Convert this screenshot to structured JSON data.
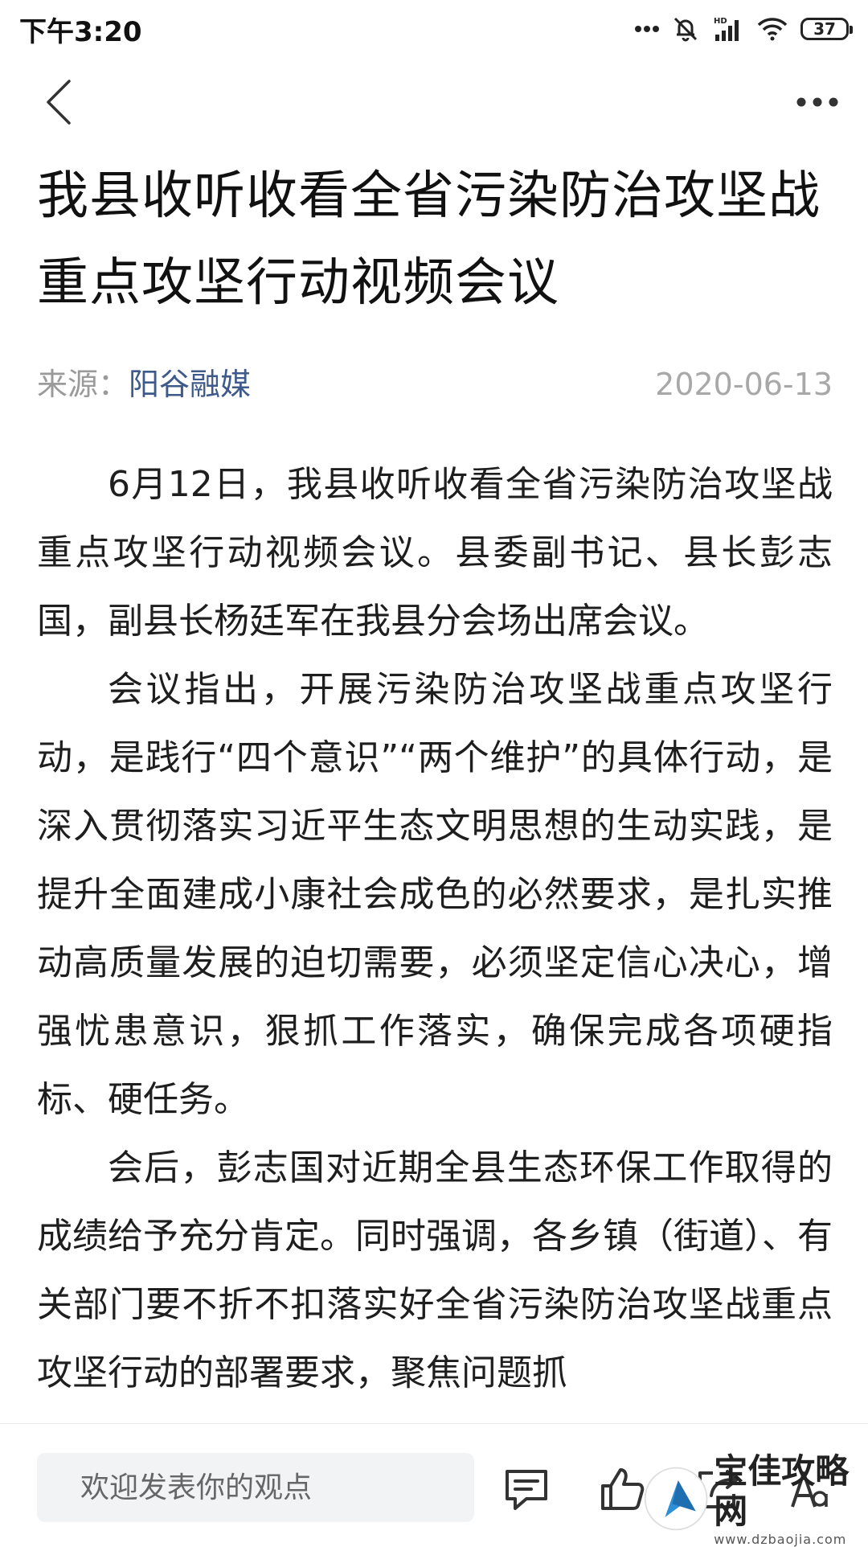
{
  "status_bar": {
    "time": "下午3:20",
    "battery": "37",
    "icons": [
      "more-dots-icon",
      "bell-off-icon",
      "hd-signal-icon",
      "wifi-icon",
      "battery-icon"
    ]
  },
  "nav": {
    "icons": [
      "back-chevron-icon",
      "more-options-icon"
    ]
  },
  "article": {
    "title": "我县收听收看全省污染防治攻坚战 重点攻坚行动视频会议",
    "source_label": "来源：",
    "source_name": "阳谷融媒",
    "date": "2020-06-13",
    "paragraphs": [
      "6月12日，我县收听收看全省污染防治攻坚战重点攻坚行动视频会议。县委副书记、县长彭志国，副县长杨廷军在我县分会场出席会议。",
      "会议指出，开展污染防治攻坚战重点攻坚行动，是践行“四个意识”“两个维护”的具体行动，是深入贯彻落实习近平生态文明思想的生动实践，是提升全面建成小康社会成色的必然要求，是扎实推动高质量发展的迫切需要，必须坚定信心决心，增强忧患意识，狠抓工作落实，确保完成各项硬指标、硬任务。",
      "会后，彭志国对近期全县生态环保工作取得的成绩给予充分肯定。同时强调，各乡镇（街道）、有关部门要不折不扣落实好全省污染防治攻坚战重点攻坚行动的部署要求，聚焦问题抓"
    ]
  },
  "bottom_bar": {
    "comment_placeholder": "欢迎发表你的观点",
    "icons": [
      "comment-icon",
      "like-icon",
      "share-icon",
      "font-size-icon"
    ]
  },
  "watermark": {
    "title": "宝佳攻略网",
    "url": "www.dzbaojia.com"
  },
  "colors": {
    "source_link": "#3d5a8a",
    "meta_gray": "#9a9a9a",
    "input_bg": "#f2f3f5"
  }
}
